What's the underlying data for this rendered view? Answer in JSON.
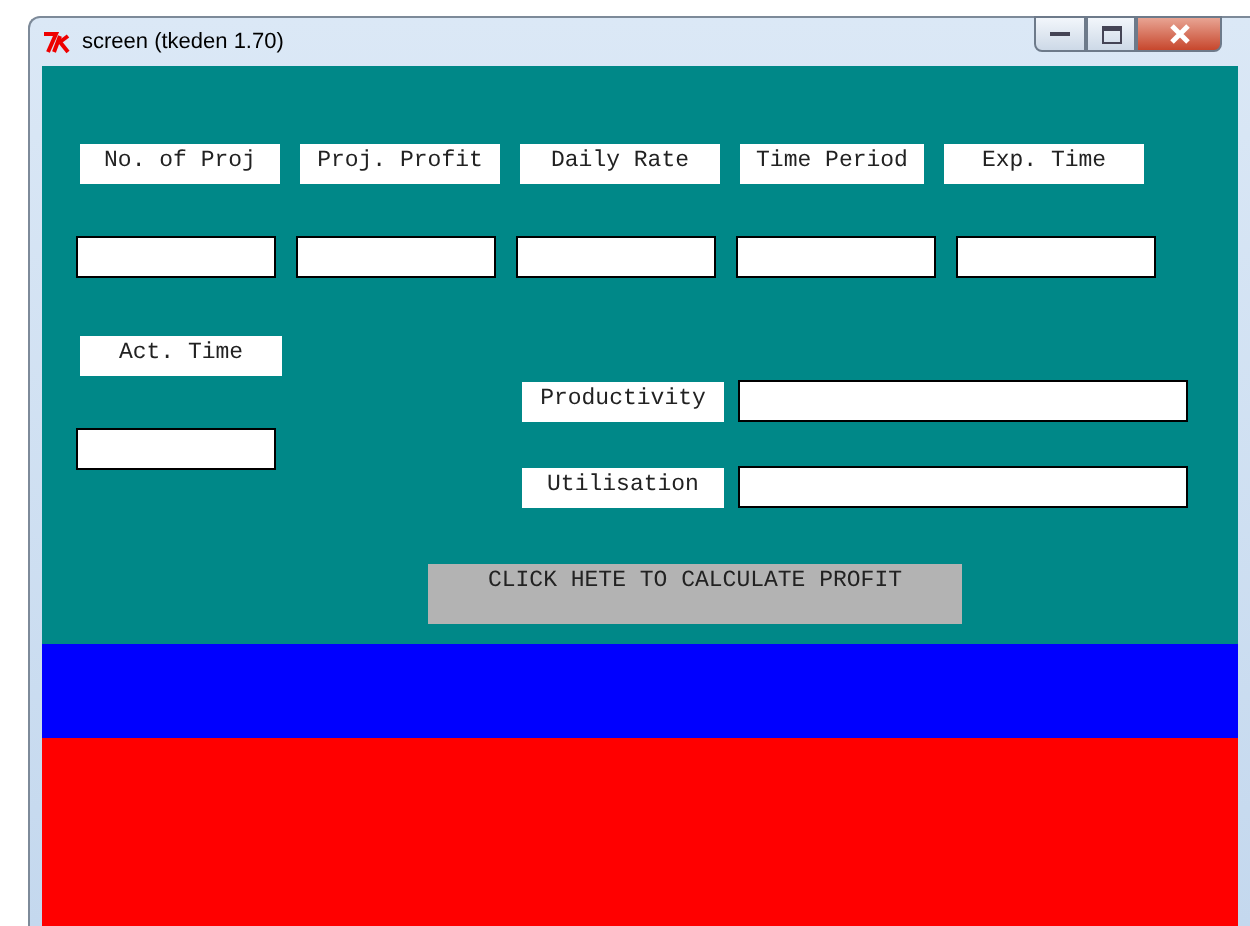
{
  "window": {
    "title": "screen (tkeden 1.70)"
  },
  "top_labels": [
    "No. of Proj",
    "Proj. Profit",
    "Daily Rate",
    "Time Period",
    "Exp. Time"
  ],
  "act_time": {
    "label": "Act. Time"
  },
  "results": [
    {
      "label": "Productivity"
    },
    {
      "label": "Utilisation"
    }
  ],
  "calculate_button": {
    "label": "CLICK HETE TO CALCULATE PROFIT"
  }
}
